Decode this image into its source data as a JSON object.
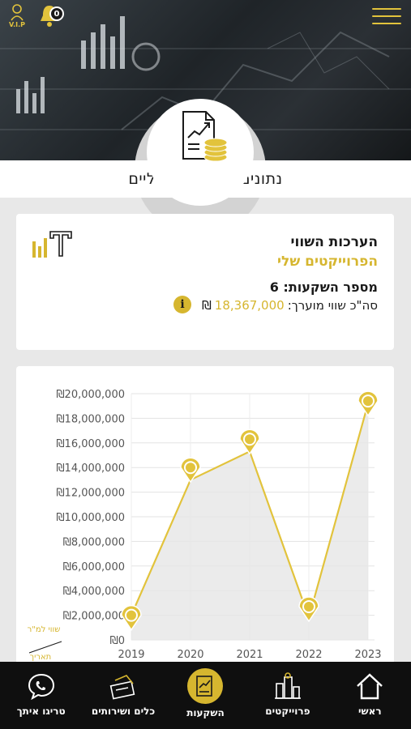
{
  "header": {
    "vip_label": "V.I.P",
    "notification_count": "0",
    "page_title": "נתונים פיננסיים כלליים"
  },
  "summary": {
    "heading": "הערכות השווי",
    "subheading": "הפרוייקטים שלי",
    "investments_label": "מספר השקעות: 6",
    "total_label": "סה\"כ שווי מוערך:",
    "total_value": "18,367,000",
    "currency": "₪"
  },
  "chart_data": {
    "type": "line",
    "categories": [
      "2019",
      "2020",
      "2021",
      "2022",
      "2023"
    ],
    "series": [
      {
        "values": [
          2000000,
          13000000,
          15300000,
          1800000,
          19200000
        ]
      }
    ],
    "marker_values": [
      2000000,
      14000000,
      16300000,
      2700000,
      19400000
    ],
    "ylim": [
      0,
      20000000
    ],
    "y_ticks": [
      "₪0",
      "₪2,000,000",
      "₪4,000,000",
      "₪6,000,000",
      "₪8,000,000",
      "₪10,000,000",
      "₪12,000,000",
      "₪14,000,000",
      "₪16,000,000",
      "₪18,000,000",
      "₪20,000,000"
    ],
    "ylabel": "שווי למ\"ר",
    "xlabel": "תאריך",
    "line_color": "#e2c33c",
    "grid": true
  },
  "nav": [
    {
      "label": "ראשי",
      "icon": "home-icon",
      "active": false
    },
    {
      "label": "פרוייקטים",
      "icon": "projects-icon",
      "active": false
    },
    {
      "label": "השקעות",
      "icon": "investments-icon",
      "active": true
    },
    {
      "label": "כלים ושירותים",
      "icon": "tools-icon",
      "active": false
    },
    {
      "label": "טריגו איתך",
      "icon": "phone-chat-icon",
      "active": false
    }
  ],
  "colors": {
    "accent": "#d6b62f",
    "dark": "#0f0f0f"
  }
}
